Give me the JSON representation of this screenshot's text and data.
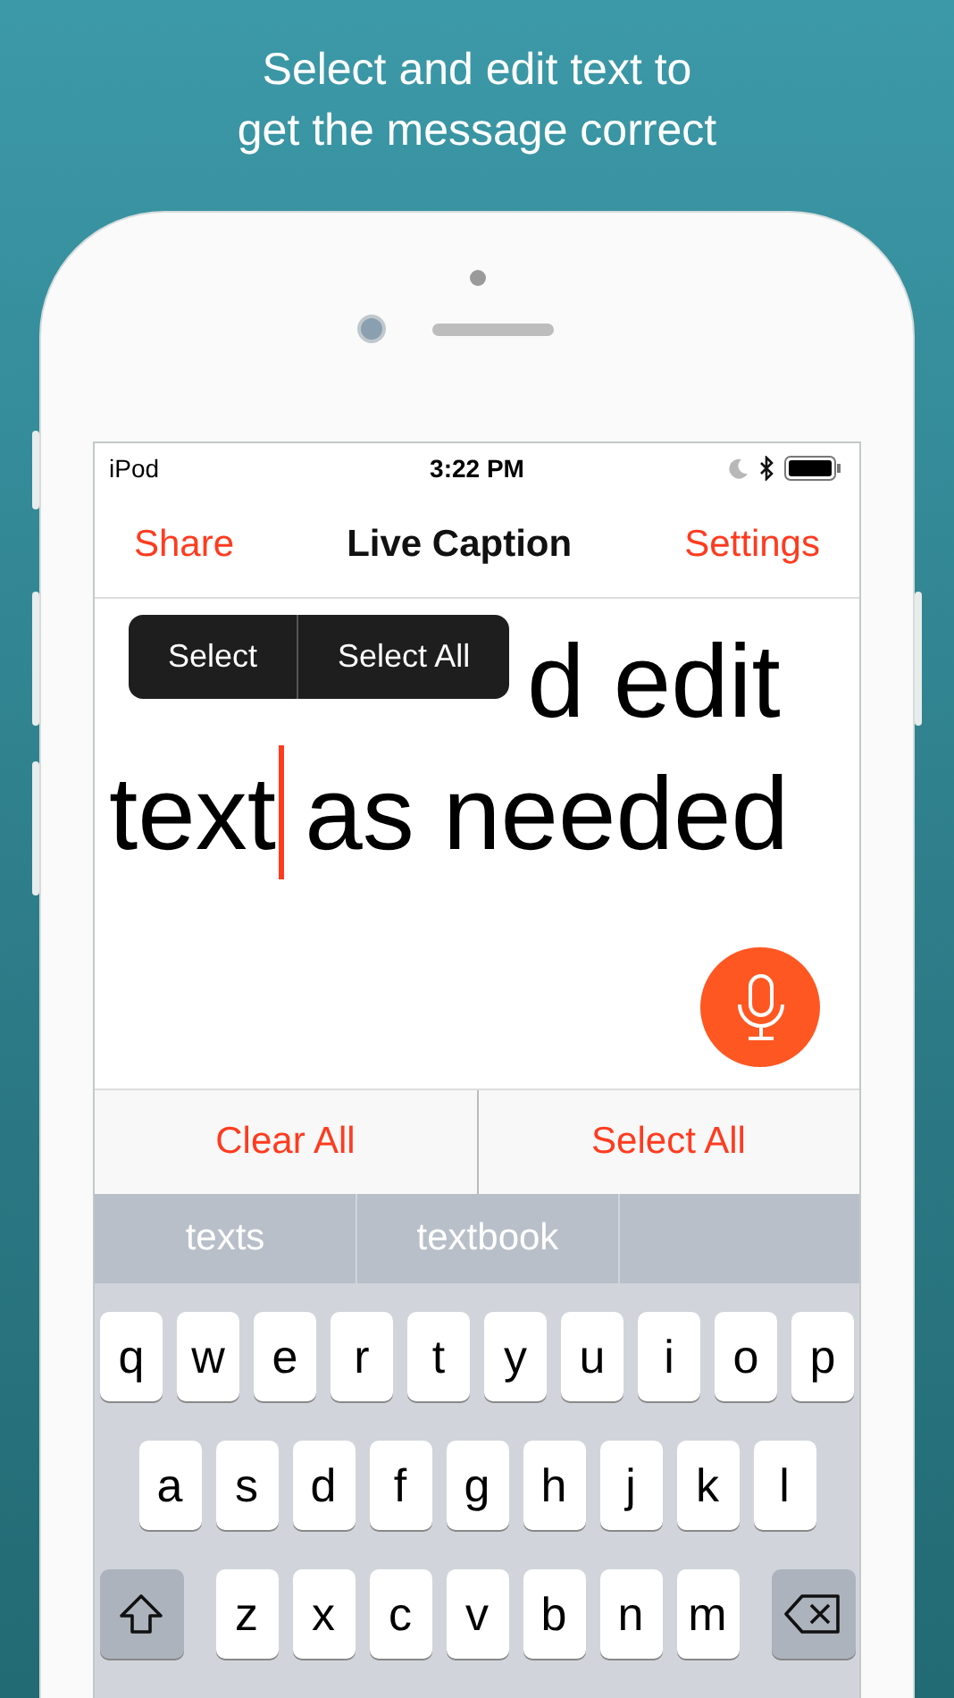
{
  "headline": [
    "Select and edit text to",
    "get the message correct"
  ],
  "status_bar": {
    "carrier": "iPod",
    "time": "3:22 PM"
  },
  "nav_bar": {
    "left": "Share",
    "title": "Live Caption",
    "right": "Settings"
  },
  "caption": {
    "lines": [
      "d edit",
      "text as needed"
    ]
  },
  "edit_menu": [
    "Select",
    "Select All"
  ],
  "actions": [
    "Clear All",
    "Select All"
  ],
  "suggestions": [
    "texts",
    "textbook"
  ],
  "keyboard": {
    "rows": [
      [
        "q",
        "w",
        "e",
        "r",
        "t",
        "y",
        "u",
        "i",
        "o",
        "p"
      ],
      [
        "a",
        "s",
        "d",
        "f",
        "g",
        "h",
        "j",
        "k",
        "l"
      ],
      [
        "z",
        "x",
        "c",
        "v",
        "b",
        "n",
        "m"
      ]
    ]
  }
}
